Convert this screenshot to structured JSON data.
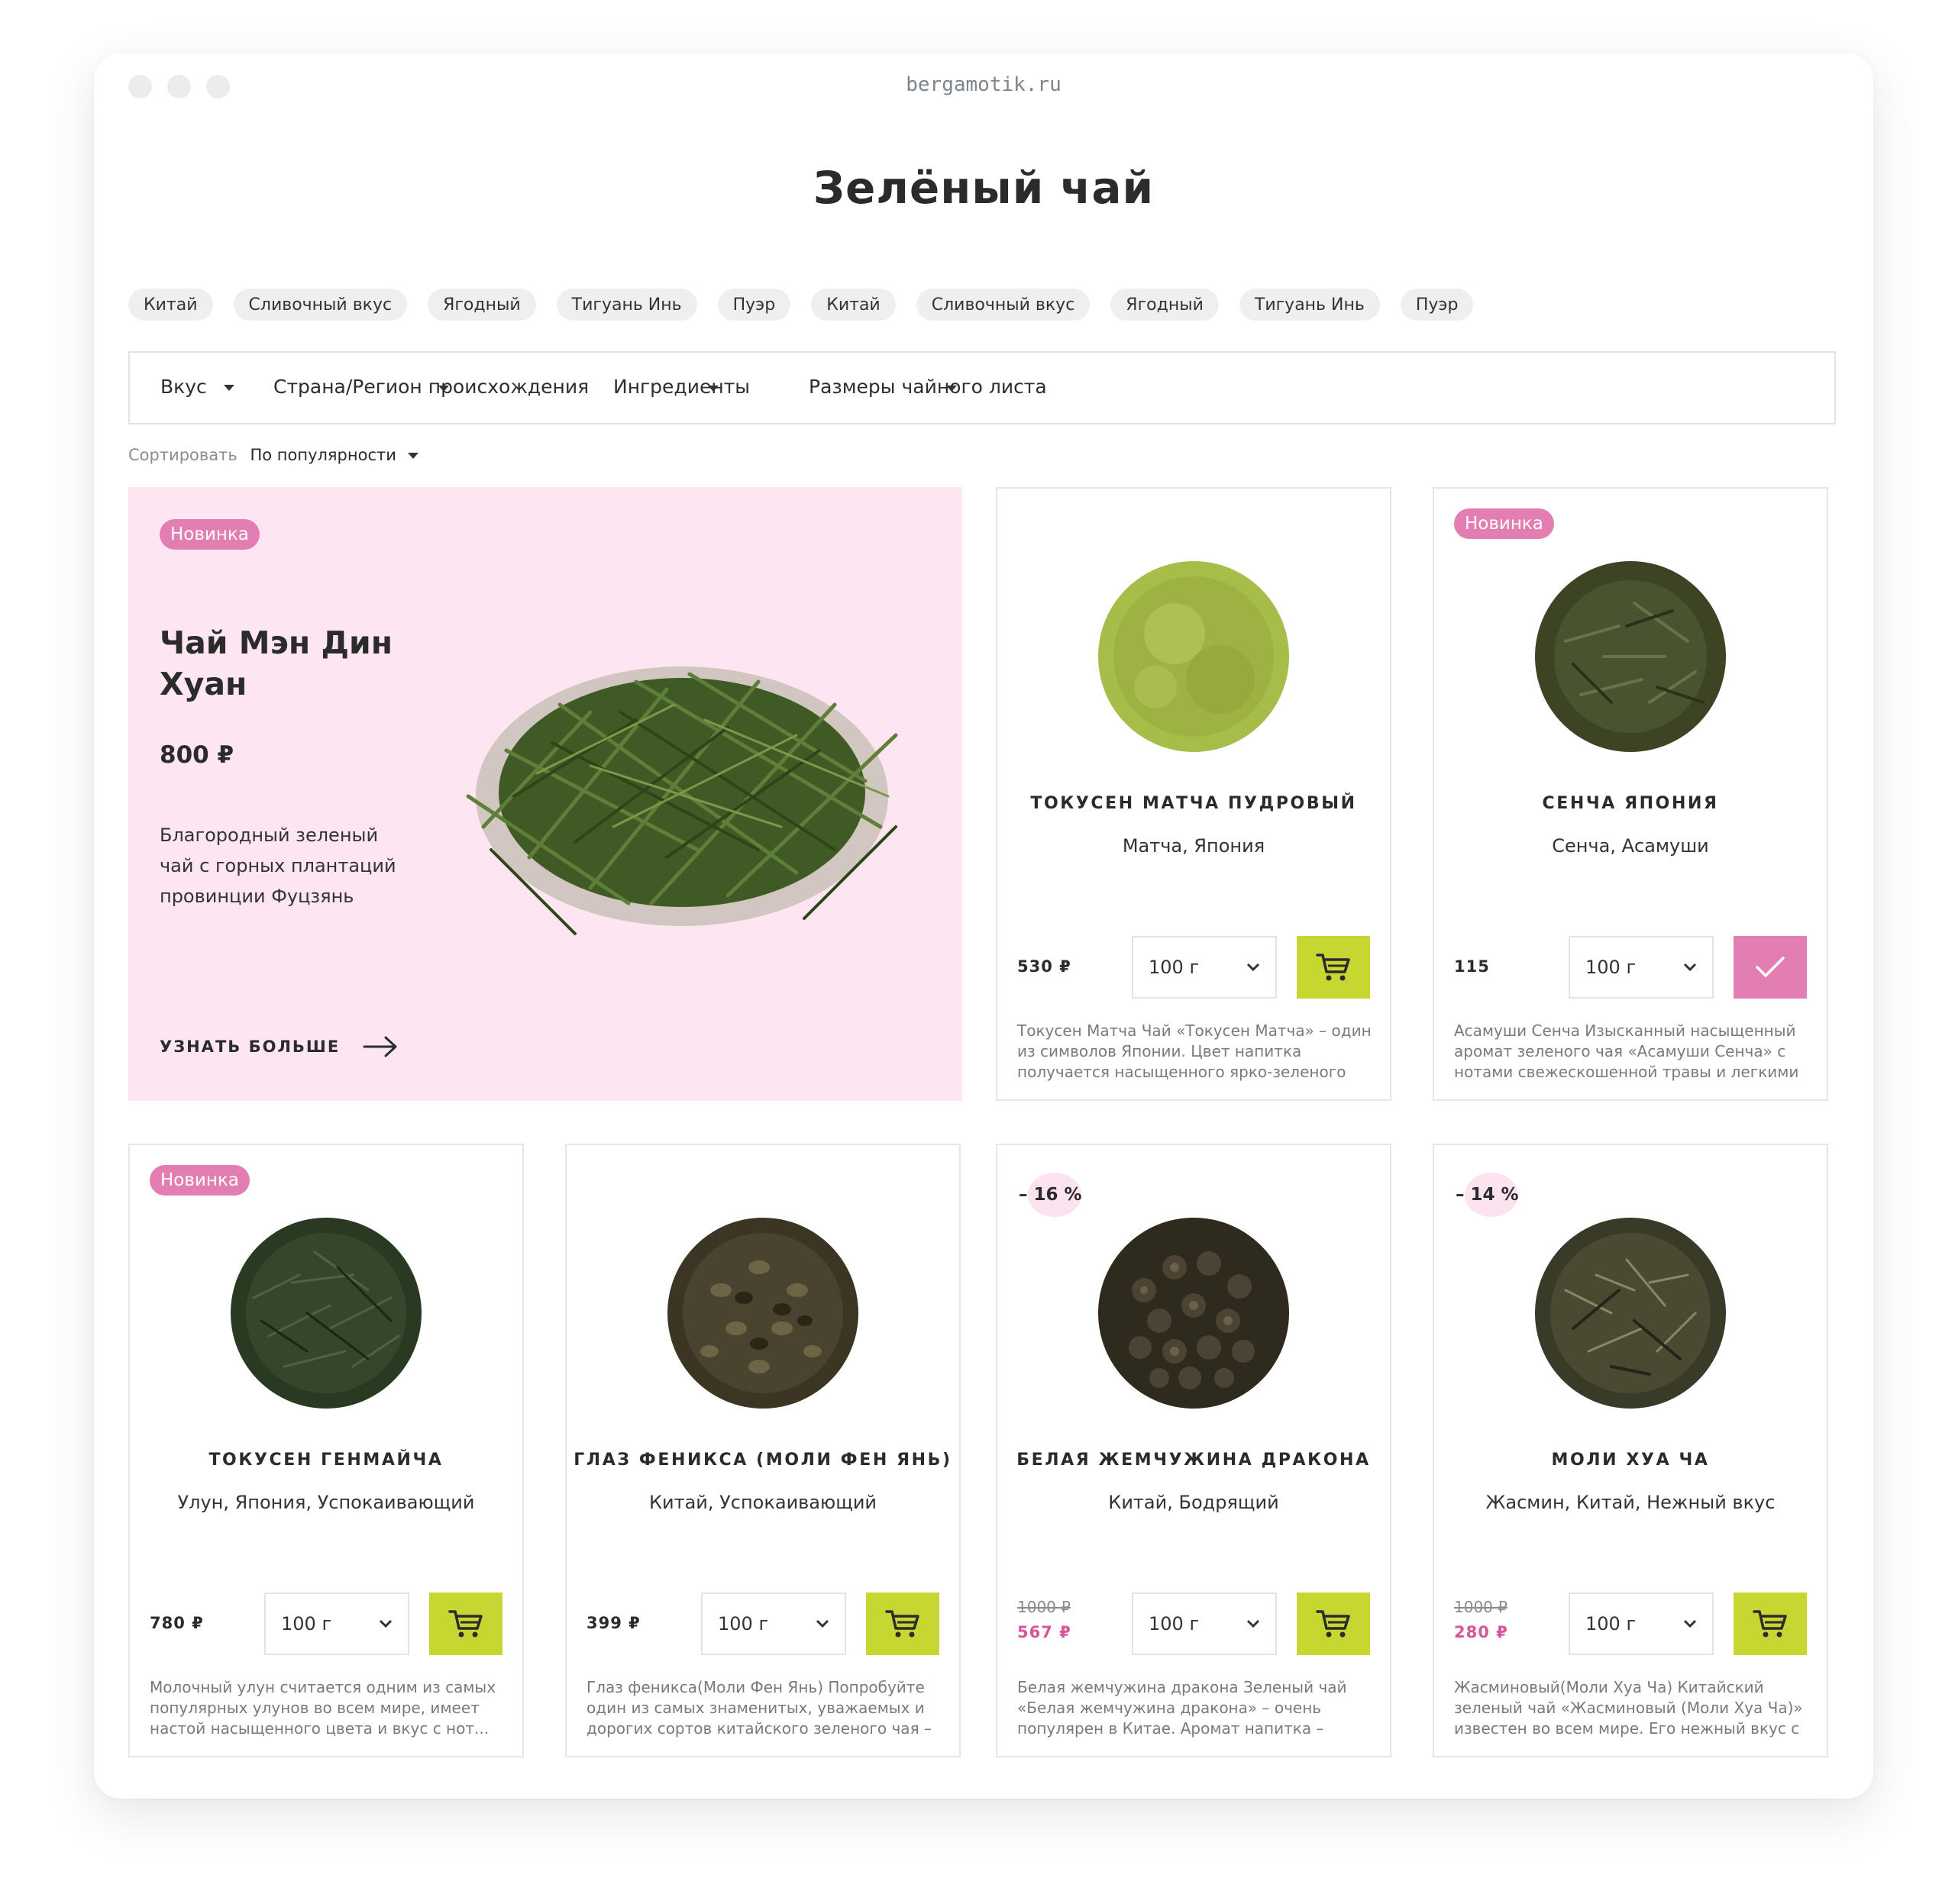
{
  "browser": {
    "url": "bergamotik.ru"
  },
  "page": {
    "title": "Зелёный чай"
  },
  "tags": [
    "Китай",
    "Сливочный вкус",
    "Ягодный",
    "Тигуань Инь",
    "Пуэр",
    "Китай",
    "Сливочный вкус",
    "Ягодный",
    "Тигуань Инь",
    "Пуэр"
  ],
  "filters": {
    "taste": "Вкус",
    "country": "Страна/Регион происхождения",
    "ingredients": "Ингредиенты",
    "leaf_size": "Размеры чайного листа"
  },
  "sort": {
    "label": "Сортировать",
    "value": "По популярности"
  },
  "featured": {
    "badge": "Новинка",
    "title": "Чай Мэн Дин Хуан",
    "price": "800 ₽",
    "description": "Благородный зеленый чай с горных плантаций провинции Фуцзянь",
    "more": "УЗНАТЬ БОЛЬШЕ"
  },
  "products": [
    {
      "name": "ТОКУСЕН МАТЧА ПУДРОВЫЙ",
      "sub": "Матча, Япония",
      "price": "530 ₽",
      "qty": "100 г",
      "description": "Токусен Матча Чай «Токусен Матча» – один из символов Японии. Цвет напитка получается насыщенного ярко-зеленого",
      "button": "cart"
    },
    {
      "badge": "Новинка",
      "name": "СЕНЧА ЯПОНИЯ",
      "sub": "Сенча, Асамуши",
      "price": "115",
      "qty": "100 г",
      "description": "Асамуши Сенча Изысканный насыщенный аромат зеленого чая «Асамуши Сенча» с нотами свежескошенной травы и легкими",
      "button": "check"
    },
    {
      "badge": "Новинка",
      "name": "ТОКУСЕН ГЕНМАЙЧА",
      "sub": "Улун, Япония, Успокаивающий",
      "price": "780 ₽",
      "qty": "100 г",
      "description": "Молочный улун считается одним из самых популярных улунов во всем мире, имеет настой насыщенного цвета и вкус с нот...",
      "button": "cart"
    },
    {
      "name": "ГЛАЗ ФЕНИКСА (МОЛИ ФЕН ЯНЬ)",
      "sub": "Китай, Успокаивающий",
      "price": "399 ₽",
      "qty": "100 г",
      "description": "Глаз феникса(Моли Фен Янь) Попробуйте один из самых знаменитых, уважаемых и дорогих сортов китайского зеленого чая –",
      "button": "cart"
    },
    {
      "discount": "– 16 %",
      "name": "БЕЛАЯ ЖЕМЧУЖИНА ДРАКОНА",
      "sub": "Китай, Бодрящий",
      "old_price": "1000 ₽",
      "price": "567 ₽",
      "qty": "100 г",
      "description": "Белая жемчужина дракона Зеленый чай «Белая жемчужина дракона» – очень популярен в Китае. Аромат напитка –",
      "button": "cart"
    },
    {
      "discount": "– 14 %",
      "name": "МОЛИ ХУА ЧА",
      "sub": "Жасмин, Китай, Нежный вкус",
      "old_price": "1000 ₽",
      "price": "280 ₽",
      "qty": "100 г",
      "description": "Жасминовый(Моли Хуа Ча) Китайский зеленый чай «Жасминовый (Моли Хуа Ча)» известен во всем мире. Его нежный вкус с",
      "button": "cart"
    }
  ],
  "colors": {
    "accent_green": "#c7d631",
    "accent_pink": "#e37eb2",
    "featured_bg": "#fde6f1",
    "sale_price": "#d9559b"
  }
}
